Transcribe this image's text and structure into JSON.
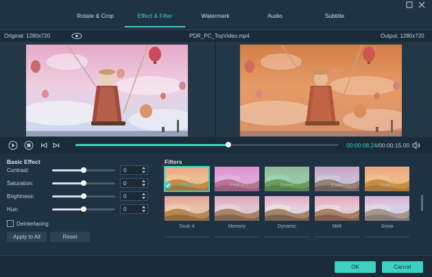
{
  "tabs": [
    {
      "label": "Rotate & Crop"
    },
    {
      "label": "Effect & Filter"
    },
    {
      "label": "Watermark"
    },
    {
      "label": "Audio"
    },
    {
      "label": "Subtitle"
    }
  ],
  "preview": {
    "original_label": "Original: 1280x720",
    "file_name": "PDR_PC_TopVideo.mp4",
    "output_label": "Output: 1280x720"
  },
  "player": {
    "current_time": "00:00:08.24",
    "total_time": "/00:00:15.00",
    "progress": 0.58
  },
  "basic_effect": {
    "title": "Basic Effect",
    "items": [
      {
        "label": "Contrast:",
        "value": "0",
        "level": 0.5
      },
      {
        "label": "Saturation:",
        "value": "0",
        "level": 0.5
      },
      {
        "label": "Brightness:",
        "value": "0",
        "level": 0.5
      },
      {
        "label": "Hue:",
        "value": "0",
        "level": 0.5
      }
    ],
    "deinterlacing_label": "Deinterlacing",
    "deinterlacing_checked": false,
    "apply_all_label": "Apply to All",
    "reset_label": "Reset"
  },
  "filters": {
    "title": "Filters",
    "items": [
      {
        "name": "Dusk 3",
        "selected": true
      },
      {
        "name": "Pink 2",
        "selected": false
      },
      {
        "name": "Green",
        "selected": false
      },
      {
        "name": "Dawn",
        "selected": false
      },
      {
        "name": "Dusk 1",
        "selected": false
      },
      {
        "name": "Dusk 4",
        "selected": false
      },
      {
        "name": "Memory",
        "selected": false
      },
      {
        "name": "Dynamic",
        "selected": false
      },
      {
        "name": "Melt",
        "selected": false
      },
      {
        "name": "Snow",
        "selected": false
      }
    ]
  },
  "footer": {
    "ok_label": "OK",
    "cancel_label": "Cancel"
  },
  "colors": {
    "accent": "#3dd2c0",
    "background": "#1e3243",
    "panel": "#1a2b39"
  }
}
